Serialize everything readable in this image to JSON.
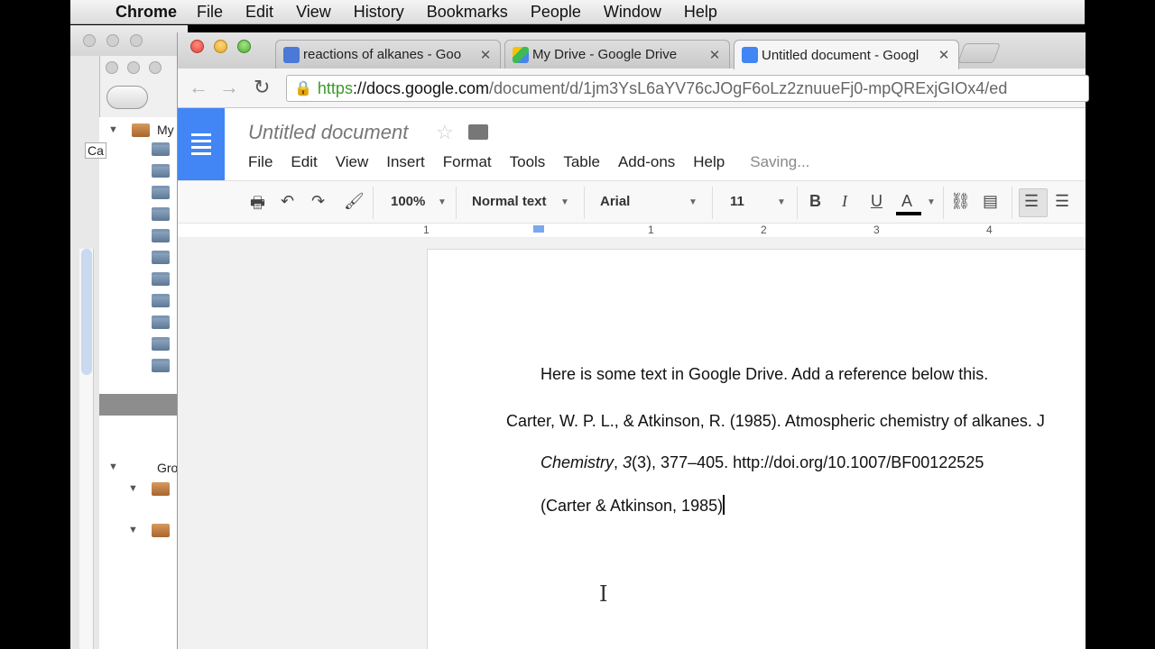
{
  "mac_menubar": {
    "app": "Chrome",
    "items": [
      "File",
      "Edit",
      "View",
      "History",
      "Bookmarks",
      "People",
      "Window",
      "Help"
    ]
  },
  "background_app": {
    "labels": [
      "My",
      "Ca",
      "Gro"
    ]
  },
  "tabs": [
    {
      "title": "reactions of alkanes - Goo"
    },
    {
      "title": "My Drive - Google Drive"
    },
    {
      "title": "Untitled document - Googl"
    }
  ],
  "omnibox": {
    "scheme": "https",
    "host": "://docs.google.com",
    "path": "/document/d/1jm3YsL6aYV76cJOgF6oLz2znuueFj0-mpQRExjGIOx4/ed"
  },
  "docs": {
    "title": "Untitled document",
    "menu": [
      "File",
      "Edit",
      "View",
      "Insert",
      "Format",
      "Tools",
      "Table",
      "Add-ons",
      "Help"
    ],
    "status": "Saving...",
    "toolbar": {
      "zoom": "100%",
      "style": "Normal text",
      "font": "Arial",
      "size": "11"
    },
    "ruler_numbers": [
      "1",
      "1",
      "2",
      "3",
      "4"
    ],
    "content": {
      "line1": "Here is some text in Google Drive. Add a reference below this.",
      "ref_line1": "Carter, W. P. L., & Atkinson, R. (1985). Atmospheric chemistry of alkanes. J",
      "ref_italic": "Chemistry",
      "ref_sep": ", ",
      "ref_vol": "3",
      "ref_rest": "(3), 377–405. http://doi.org/10.1007/BF00122525",
      "citation": "(Carter & Atkinson, 1985)"
    }
  }
}
